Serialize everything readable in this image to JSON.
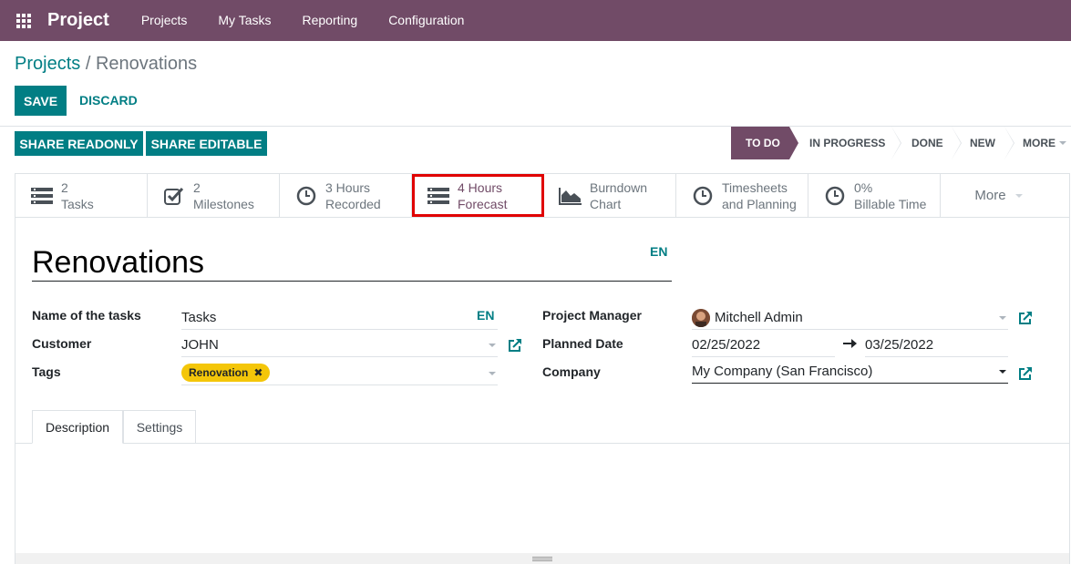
{
  "navbar": {
    "brand": "Project",
    "menu": [
      "Projects",
      "My Tasks",
      "Reporting",
      "Configuration"
    ]
  },
  "breadcrumb": {
    "parent": "Projects",
    "separator": "/",
    "current": "Renovations"
  },
  "buttons": {
    "save": "SAVE",
    "discard": "DISCARD",
    "share_readonly": "SHARE READONLY",
    "share_editable": "SHARE EDITABLE"
  },
  "stages": [
    "TO DO",
    "IN PROGRESS",
    "DONE",
    "NEW",
    "MORE"
  ],
  "active_stage": "TO DO",
  "smart_buttons": [
    {
      "value": "2",
      "label": "Tasks",
      "icon": "tasks-icon"
    },
    {
      "value": "2",
      "label": "Milestones",
      "icon": "check-square-icon"
    },
    {
      "value": "3 Hours",
      "label": "Recorded",
      "icon": "clock-icon"
    },
    {
      "value": "4 Hours",
      "label": "Forecast",
      "icon": "tasks-icon"
    },
    {
      "value": "Burndown",
      "label": "Chart",
      "icon": "area-chart-icon"
    },
    {
      "value": "Timesheets",
      "label": "and Planning",
      "icon": "clock-icon"
    },
    {
      "value": "0%",
      "label": "Billable Time",
      "icon": "clock-icon"
    }
  ],
  "smart_more": "More",
  "record": {
    "title": "Renovations",
    "lang": "EN"
  },
  "fields": {
    "task_name": {
      "label": "Name of the tasks",
      "value": "Tasks",
      "lang": "EN"
    },
    "customer": {
      "label": "Customer",
      "value": "JOHN"
    },
    "tags": {
      "label": "Tags",
      "value": "Renovation"
    },
    "project_manager": {
      "label": "Project Manager",
      "value": "Mitchell Admin"
    },
    "planned_date": {
      "label": "Planned Date",
      "start": "02/25/2022",
      "end": "03/25/2022"
    },
    "company": {
      "label": "Company",
      "value": "My Company (San Francisco)"
    }
  },
  "tabs": [
    "Description",
    "Settings"
  ],
  "colors": {
    "brand": "#714b67",
    "primary": "#017e84",
    "tag": "#f4c609",
    "highlight": "#e00000"
  }
}
